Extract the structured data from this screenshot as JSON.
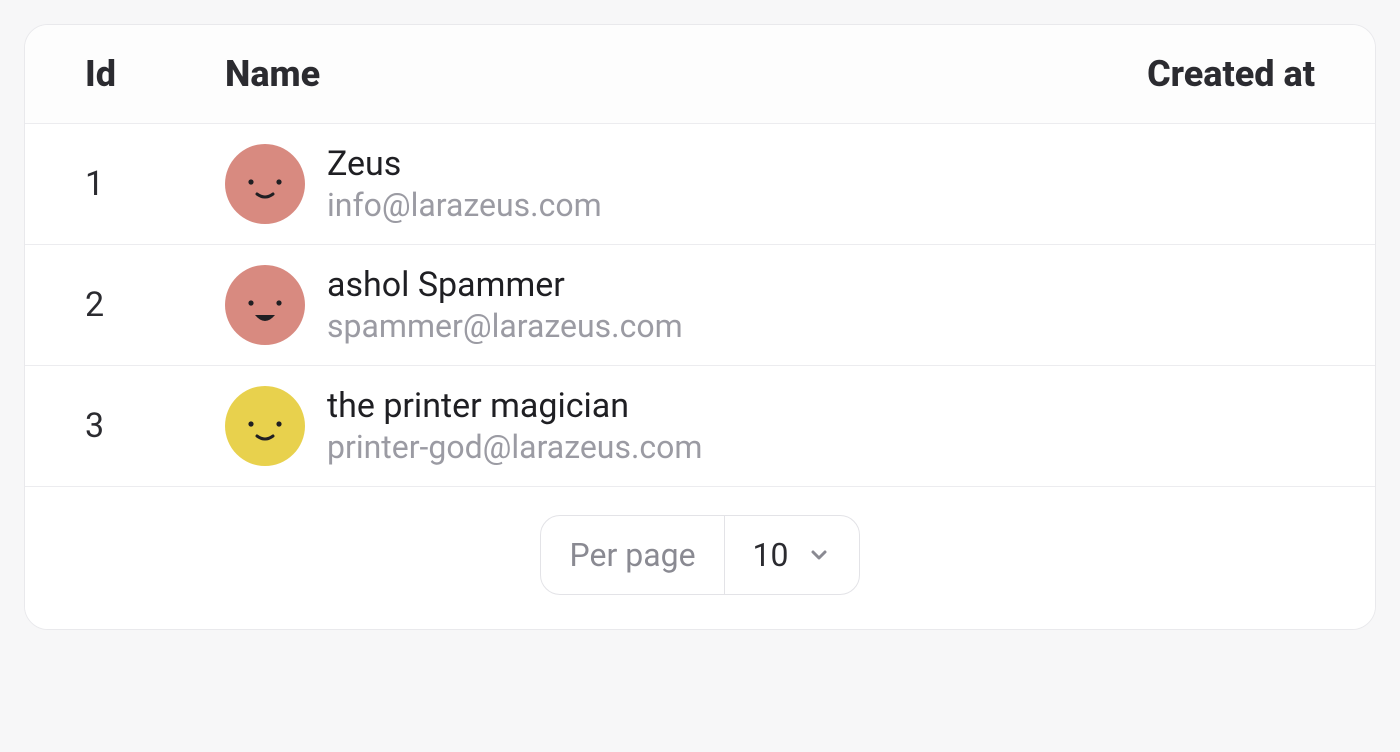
{
  "columns": {
    "id": "Id",
    "name": "Name",
    "created_at": "Created at"
  },
  "rows": [
    {
      "id": "1",
      "name": "Zeus",
      "email": "info@larazeus.com",
      "avatar_color": "#d88a80",
      "created_at": ""
    },
    {
      "id": "2",
      "name": "ashol Spammer",
      "email": "spammer@larazeus.com",
      "avatar_color": "#d88a80",
      "created_at": ""
    },
    {
      "id": "3",
      "name": "the printer magician",
      "email": "printer-god@larazeus.com",
      "avatar_color": "#e8d14d",
      "created_at": ""
    }
  ],
  "pagination": {
    "label": "Per page",
    "value": "10"
  }
}
